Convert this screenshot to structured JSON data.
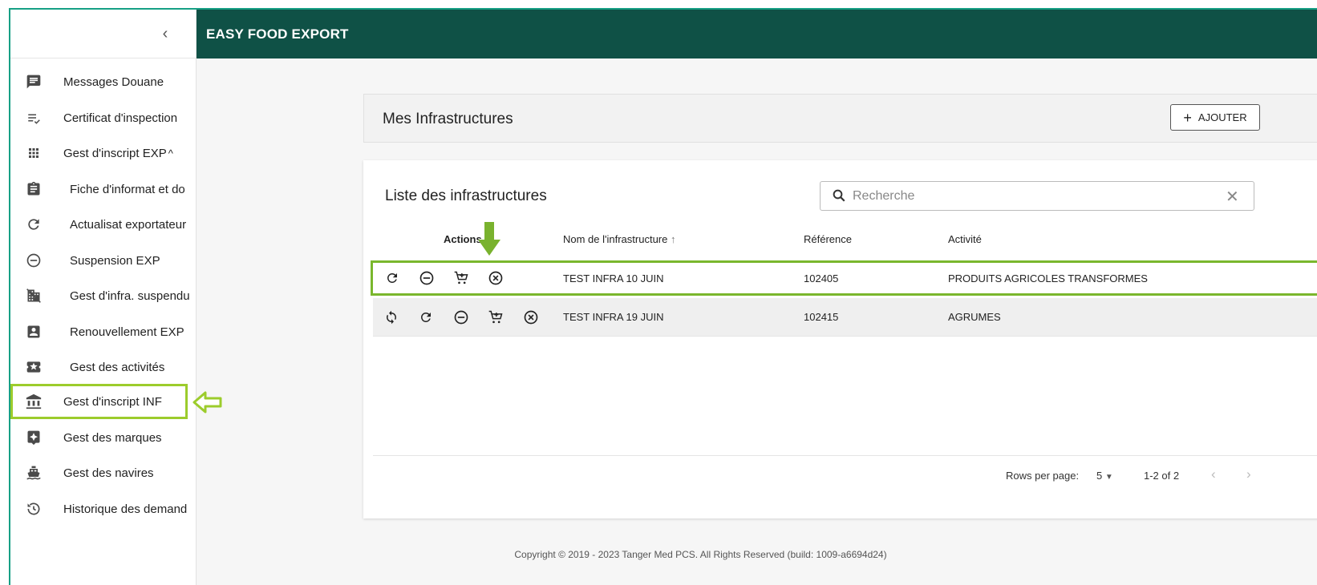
{
  "header": {
    "title": "EASY FOOD EXPORT"
  },
  "sidebar": {
    "collapse_icon": "chevron-left-icon",
    "items": [
      {
        "label": "Messages Douane",
        "icon": "message-icon"
      },
      {
        "label": "Certificat d'inspection",
        "icon": "list-check-icon"
      },
      {
        "label": "Gest d'inscript EXP",
        "icon": "apps-icon",
        "expanded": true
      },
      {
        "label": "Fiche d'informat et do",
        "icon": "clipboard-icon"
      },
      {
        "label": "Actualisat exportateur",
        "icon": "refresh-icon"
      },
      {
        "label": "Suspension EXP",
        "icon": "minus-circle-icon"
      },
      {
        "label": "Gest d'infra. suspendu",
        "icon": "domain-off-icon"
      },
      {
        "label": "Renouvellement EXP",
        "icon": "account-box-icon"
      },
      {
        "label": "Gest des activités",
        "icon": "star-ticket-icon"
      },
      {
        "label": "Gest d'inscript INF",
        "icon": "bank-icon",
        "active": true
      },
      {
        "label": "Gest des marques",
        "icon": "brand-icon"
      },
      {
        "label": "Gest des navires",
        "icon": "ferry-icon"
      },
      {
        "label": "Historique des demand",
        "icon": "history-icon"
      }
    ]
  },
  "infra_card": {
    "title": "Mes Infrastructures",
    "add_label": "AJOUTER"
  },
  "list_card": {
    "title": "Liste des infrastructures",
    "search": {
      "placeholder": "Recherche",
      "value": ""
    },
    "columns": {
      "actions": "Actions",
      "name": "Nom de l'infrastructure",
      "reference": "Référence",
      "activity": "Activité"
    },
    "rows": [
      {
        "name": "TEST INFRA 10 JUIN",
        "reference": "102405",
        "activity": "PRODUITS AGRICOLES TRANSFORMES",
        "actions": [
          "refresh-icon",
          "minus-circle-icon",
          "cart-plus-icon",
          "close-circle-icon"
        ]
      },
      {
        "name": "TEST INFRA 19 JUIN",
        "reference": "102415",
        "activity": "AGRUMES",
        "actions": [
          "sync-icon",
          "refresh-icon",
          "minus-circle-icon",
          "cart-plus-icon",
          "close-circle-icon"
        ]
      }
    ],
    "pagination": {
      "rows_per_page_label": "Rows per page:",
      "rows_per_page": "5",
      "range": "1-2 of 2"
    }
  },
  "footer": {
    "copyright": "Copyright © 2019 - 2023 Tanger Med PCS. All Rights Reserved (build: 1009-a6694d24)"
  },
  "colors": {
    "header": "#0f5146",
    "highlight": "#9ccc2c",
    "frame": "#17a085"
  }
}
